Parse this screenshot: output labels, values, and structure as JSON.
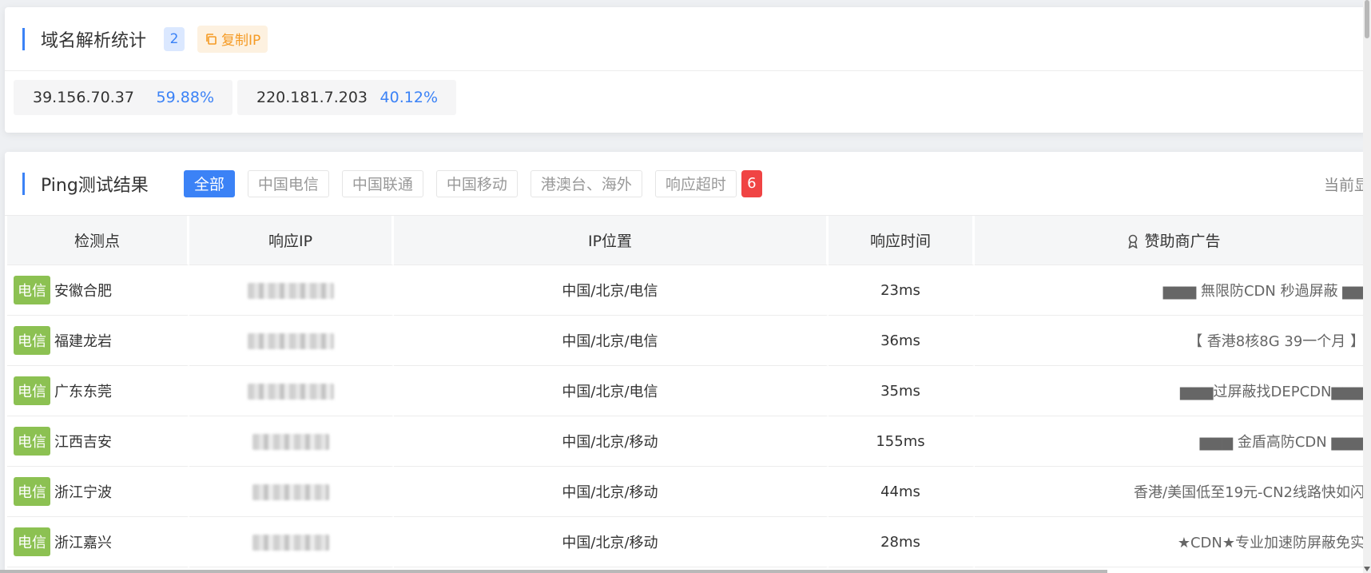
{
  "dns_stats": {
    "title": "域名解析统计",
    "count": "2",
    "copy_label": "复制IP",
    "items": [
      {
        "ip": "39.156.70.37",
        "pct": "59.88%"
      },
      {
        "ip": "220.181.7.203",
        "pct": "40.12%"
      }
    ]
  },
  "ping": {
    "title": "Ping测试结果",
    "tabs": [
      "全部",
      "中国电信",
      "中国联通",
      "中国移动",
      "港澳台、海外",
      "响应超时"
    ],
    "active_tab": "全部",
    "timeout_count": "6",
    "current_label": "当前显",
    "columns": [
      "检测点",
      "响应IP",
      "IP位置",
      "响应时间",
      "赞助商广告"
    ],
    "rows": [
      {
        "isp": "电信",
        "node": "安徽合肥",
        "location": "中国/北京/电信",
        "time": "23ms",
        "ad": "▆▆▆ 無限防CDN 秒過屏蔽 ▆▆"
      },
      {
        "isp": "电信",
        "node": "福建龙岩",
        "location": "中国/北京/电信",
        "time": "36ms",
        "ad": "【 香港8核8G 39一个月 】"
      },
      {
        "isp": "电信",
        "node": "广东东莞",
        "location": "中国/北京/电信",
        "time": "35ms",
        "ad": "▆▆▆过屏蔽找DEPCDN▆▆▆"
      },
      {
        "isp": "电信",
        "node": "江西吉安",
        "location": "中国/北京/移动",
        "time": "155ms",
        "ad": "▆▆▆ 金盾高防CDN ▆▆▆"
      },
      {
        "isp": "电信",
        "node": "浙江宁波",
        "location": "中国/北京/移动",
        "time": "44ms",
        "ad": "香港/美国低至19元-CN2线路快如闪"
      },
      {
        "isp": "电信",
        "node": "浙江嘉兴",
        "location": "中国/北京/移动",
        "time": "28ms",
        "ad": "★CDN★专业加速防屏蔽免实"
      }
    ]
  },
  "colors": {
    "accent": "#3b82f6",
    "isp_tag": "#8cc152",
    "copy_orange": "#f59a23",
    "timeout_red": "#f04444"
  }
}
